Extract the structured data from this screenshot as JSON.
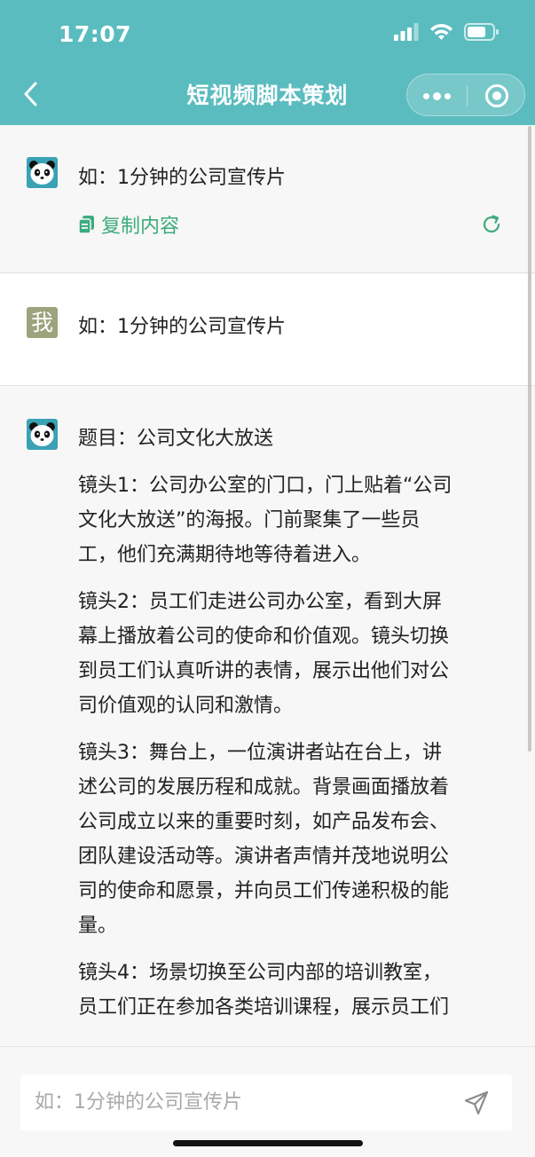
{
  "status_bar": {
    "time": "17:07"
  },
  "header": {
    "title": "短视频脚本策划"
  },
  "conversation": {
    "assistant_prompt": {
      "text": "如：1分钟的公司宣传片",
      "copy_label": "复制内容"
    },
    "user_message": {
      "avatar_char": "我",
      "text": "如：1分钟的公司宣传片"
    },
    "assistant_answer": {
      "lines": [
        "题目：公司文化大放送",
        "",
        "镜头1：公司办公室的门口，门上贴着“公司",
        "文化大放送”的海报。门前聚集了一些员",
        "工，他们充满期待地等待着进入。",
        "",
        "镜头2：员工们走进公司办公室，看到大屏",
        "幕上播放着公司的使命和价值观。镜头切换",
        "到员工们认真听讲的表情，展示出他们对公",
        "司价值观的认同和激情。",
        "",
        "镜头3：舞台上，一位演讲者站在台上，讲",
        "述公司的发展历程和成就。背景画面播放着",
        "公司成立以来的重要时刻，如产品发布会、",
        "团队建设活动等。演讲者声情并茂地说明公",
        "司的使命和愿景，并向员工们传递积极的能",
        "量。",
        "",
        "镜头4：场景切换至公司内部的培训教室，",
        "员工们正在参加各类培训课程，展示员工们"
      ]
    }
  },
  "input_bar": {
    "placeholder": "如：1分钟的公司宣传片"
  },
  "colors": {
    "header": "#5bbcbf",
    "accent": "#3dab7f"
  },
  "icons": [
    "back-icon",
    "more-icon",
    "close-target-icon",
    "panda-avatar-icon",
    "copy-icon",
    "refresh-icon",
    "send-icon",
    "signal-icon",
    "wifi-icon",
    "battery-icon"
  ]
}
